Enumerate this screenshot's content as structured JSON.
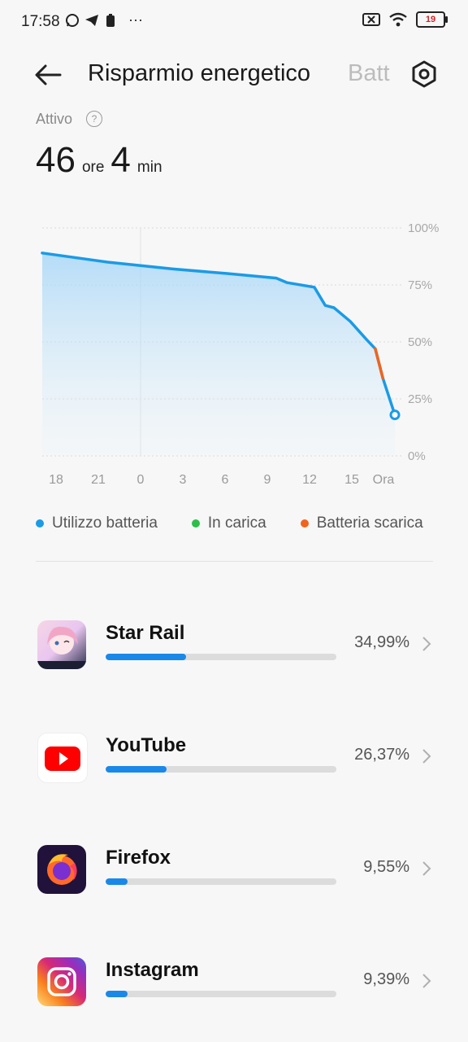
{
  "status_bar": {
    "time": "17:58",
    "battery_level": "19"
  },
  "header": {
    "title": "Risparmio energetico",
    "next_tab": "Batt"
  },
  "summary": {
    "label": "Attivo",
    "hours": "46",
    "hours_unit": "ore",
    "minutes": "4",
    "minutes_unit": "min"
  },
  "chart_data": {
    "type": "area",
    "x_ticks": [
      "18",
      "21",
      "0",
      "3",
      "6",
      "9",
      "12",
      "15",
      "Ora"
    ],
    "y_ticks": [
      "100%",
      "75%",
      "50%",
      "25%",
      "0%"
    ],
    "ylim": [
      0,
      100
    ],
    "series": [
      {
        "name": "Utilizzo batteria",
        "points": [
          [
            0,
            89
          ],
          [
            6,
            85
          ],
          [
            12,
            82
          ],
          [
            17,
            80
          ],
          [
            21.5,
            78
          ],
          [
            22.5,
            76
          ],
          [
            25,
            74
          ],
          [
            26,
            66
          ],
          [
            26.8,
            65
          ],
          [
            28.3,
            59
          ],
          [
            29.8,
            51
          ],
          [
            30.6,
            47
          ],
          [
            31.3,
            34
          ],
          [
            32.4,
            18
          ]
        ]
      }
    ],
    "discharge_segment": [
      [
        30.6,
        47
      ],
      [
        31.3,
        34
      ]
    ],
    "legend": [
      "Utilizzo batteria",
      "In carica",
      "Batteria scarica"
    ],
    "colors": {
      "usage": "#1a9be6",
      "charging": "#2bbf4a",
      "low": "#f0641e"
    }
  },
  "apps": [
    {
      "name": "Star Rail",
      "percent": "34,99%",
      "fraction": 0.3499,
      "icon": "star-rail-icon"
    },
    {
      "name": "YouTube",
      "percent": "26,37%",
      "fraction": 0.2637,
      "icon": "youtube-icon"
    },
    {
      "name": "Firefox",
      "percent": "9,55%",
      "fraction": 0.0955,
      "icon": "firefox-icon"
    },
    {
      "name": "Instagram",
      "percent": "9,39%",
      "fraction": 0.0939,
      "icon": "instagram-icon"
    }
  ]
}
